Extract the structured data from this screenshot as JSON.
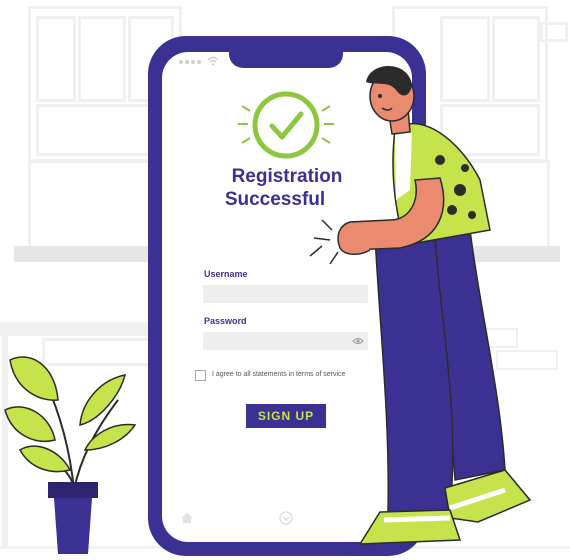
{
  "colors": {
    "accent": "#3b3192",
    "success": "#8dc63f",
    "lime": "#c5e34a",
    "skin": "#ea8b6f"
  },
  "screen": {
    "status_icons": [
      "signal-dots-icon",
      "wifi-icon"
    ],
    "success_icon": "check-circle-icon",
    "title_line1": "Registration",
    "title_line2": "Successful"
  },
  "form": {
    "username_label": "Username",
    "username_value": "",
    "password_label": "Password",
    "password_value": "",
    "password_icon": "eye-icon",
    "terms_text": "I agree to all statements in terms of service",
    "terms_checked": false,
    "signup_label": "SIGN UP"
  },
  "nav": {
    "home_icon": "home-icon",
    "down_icon": "chevron-down-circle-icon"
  }
}
